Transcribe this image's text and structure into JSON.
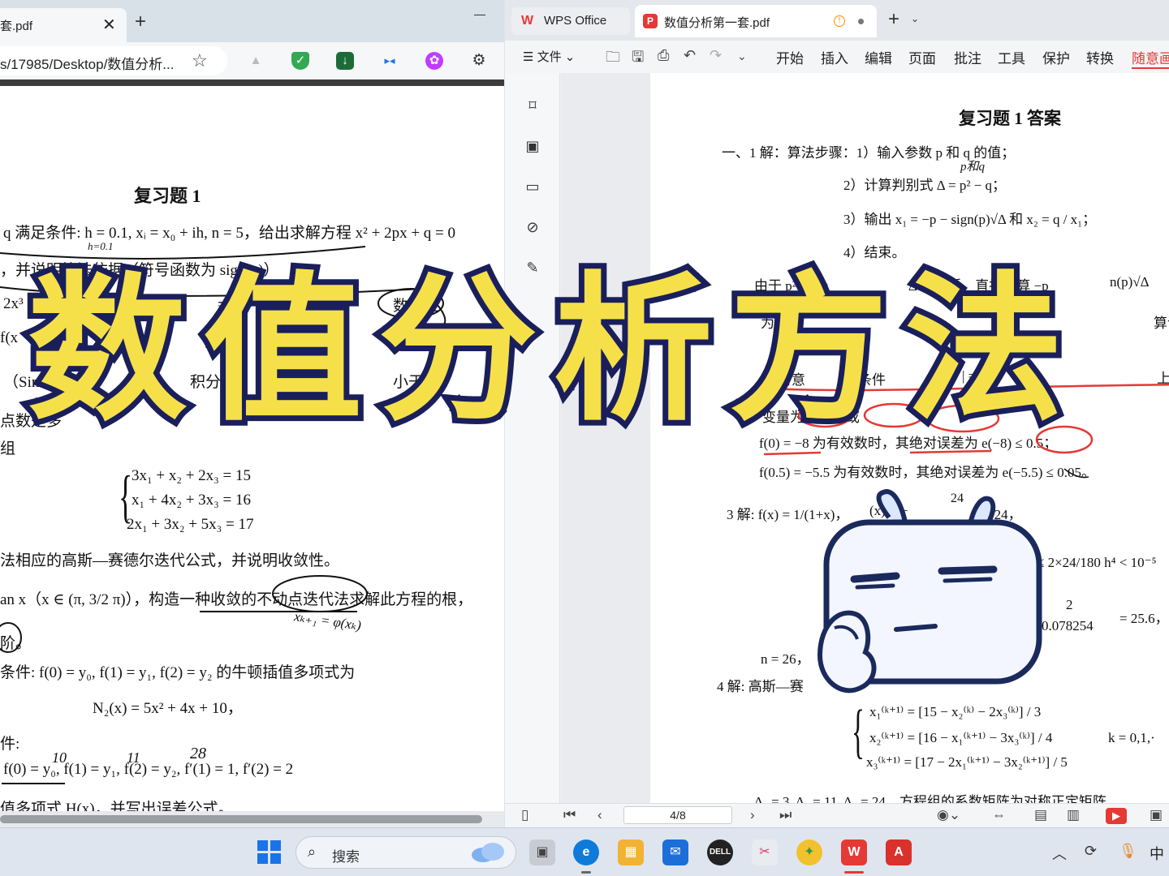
{
  "left_browser": {
    "tab_title": "套.pdf",
    "tab_close": "✕",
    "new_tab": "+",
    "address": "s/17985/Desktop/数值分析...",
    "favorite": "☆"
  },
  "left_document": {
    "title": "复习题 1",
    "lines": [
      "q 满足条件: h = 0.1, xᵢ = x₀ + ih, n = 5，给出求解方程 x² + 2px + q = 0",
      "，并说明算法依据（符号函数为 sign(x)）",
      "2x³ −",
      "f(x",
      "（Sim",
      "点数是多",
      "组",
      "3x₁ + x₂ + 2x₃ = 15",
      "x₁ + 4x₂ + 3x₃ = 16",
      "2x₁ + 3x₂ + 5x₃ = 17",
      "法相应的高斯—赛德尔迭代公式，并说明收敛性。",
      "an x（x ∈ (π, 3/2 π)），构造一种收敛的不动点迭代法求解此方程的根，",
      "阶。",
      "条件: f(0) = y₀, f(1) = y₁, f(2) = y₂ 的牛顿插值多项式为",
      "N₂(x) = 5x² + 4x + 10，",
      "件:",
      "f(0) = y₀, f(1) = y₁, f(2) = y₂, f′(1) = 1, f′(2) = 2",
      "值多项式 H(x)，并写出误差公式。"
    ],
    "fragments": [
      "在",
      "数相应",
      "积分",
      "∫",
      "小于10",
      "其"
    ],
    "handwriting": [
      "h=0.1",
      "xₖ₊₁ = φ(xₖ)",
      "10",
      "11",
      "28"
    ]
  },
  "wps": {
    "home_tab": "WPS Office",
    "doc_tab": "数值分析第一套.pdf",
    "new_tab": "+",
    "file_menu": "文件",
    "menu": [
      "开始",
      "插入",
      "编辑",
      "页面",
      "批注",
      "工具",
      "保护",
      "转换",
      "随意画"
    ],
    "active_menu": "随意画",
    "page_indicator": "4/8"
  },
  "answer_document": {
    "title": "复习题 1 答案",
    "lines": [
      "一、1  解：算法步骤：1）输入参数 p 和 q 的值；",
      "2）计算判别式 Δ = p² − q；",
      "3）输出 x₁ = −p − sign(p)√Δ 和 x₂ = q / x₁；",
      "4）结束。",
      "由于 p² >> |q",
      "Δ 很接近，直接计算 −p",
      "n(p)√Δ",
      "为:",
      "−p − s",
      "算误",
      "绝对意",
      "条件",
      "| = |6x",
      "上的",
      "变量为",
      "0 或",
      "f(0) = −8 为有效数时，其绝对误差为 e(−8) ≤ 0.5；",
      "f(0.5) = −5.5 为有效数时，其绝对误差为 e(−5.5) ≤ 0.05。",
      "3 解:  f(x) = 1/(1+x)，",
      "(x) = −",
      "24",
      "≤ 24，",
      "≤ 2×24/180 h⁴ < 10⁻⁵",
      "2",
      "0.078254",
      "= 25.6，",
      "n = 26，",
      "4 解:  高斯—赛",
      "x₁⁽ᵏ⁺¹⁾ = [15 − x₂⁽ᵏ⁾ − 2x₃⁽ᵏ⁾] / 3",
      "x₂⁽ᵏ⁺¹⁾ = [16 − x₁⁽ᵏ⁺¹⁾ − 3x₃⁽ᵏ⁾] / 4",
      "k = 0,1,·",
      "x₃⁽ᵏ⁺¹⁾ = [17 − 2x₁⁽ᵏ⁺¹⁾ − 3x₂⁽ᵏ⁺¹⁾] / 5",
      "Δ₁ = 3, Δ₂ = 11, Δ₃ = 24，方程组的系数矩阵为对称正定矩阵"
    ],
    "handwriting": [
      "p和q"
    ]
  },
  "overlay": {
    "title": "数值分析方法",
    "fill_color": "#f5e04a",
    "stroke_color": "#1a1f5c"
  },
  "taskbar": {
    "search_label": "搜索",
    "input_lang": "中"
  },
  "icons": {
    "bookmark": "bookmark-icon",
    "image": "image-icon",
    "comment": "comment-icon",
    "attachment": "attachment-icon",
    "pen": "pen-icon"
  }
}
